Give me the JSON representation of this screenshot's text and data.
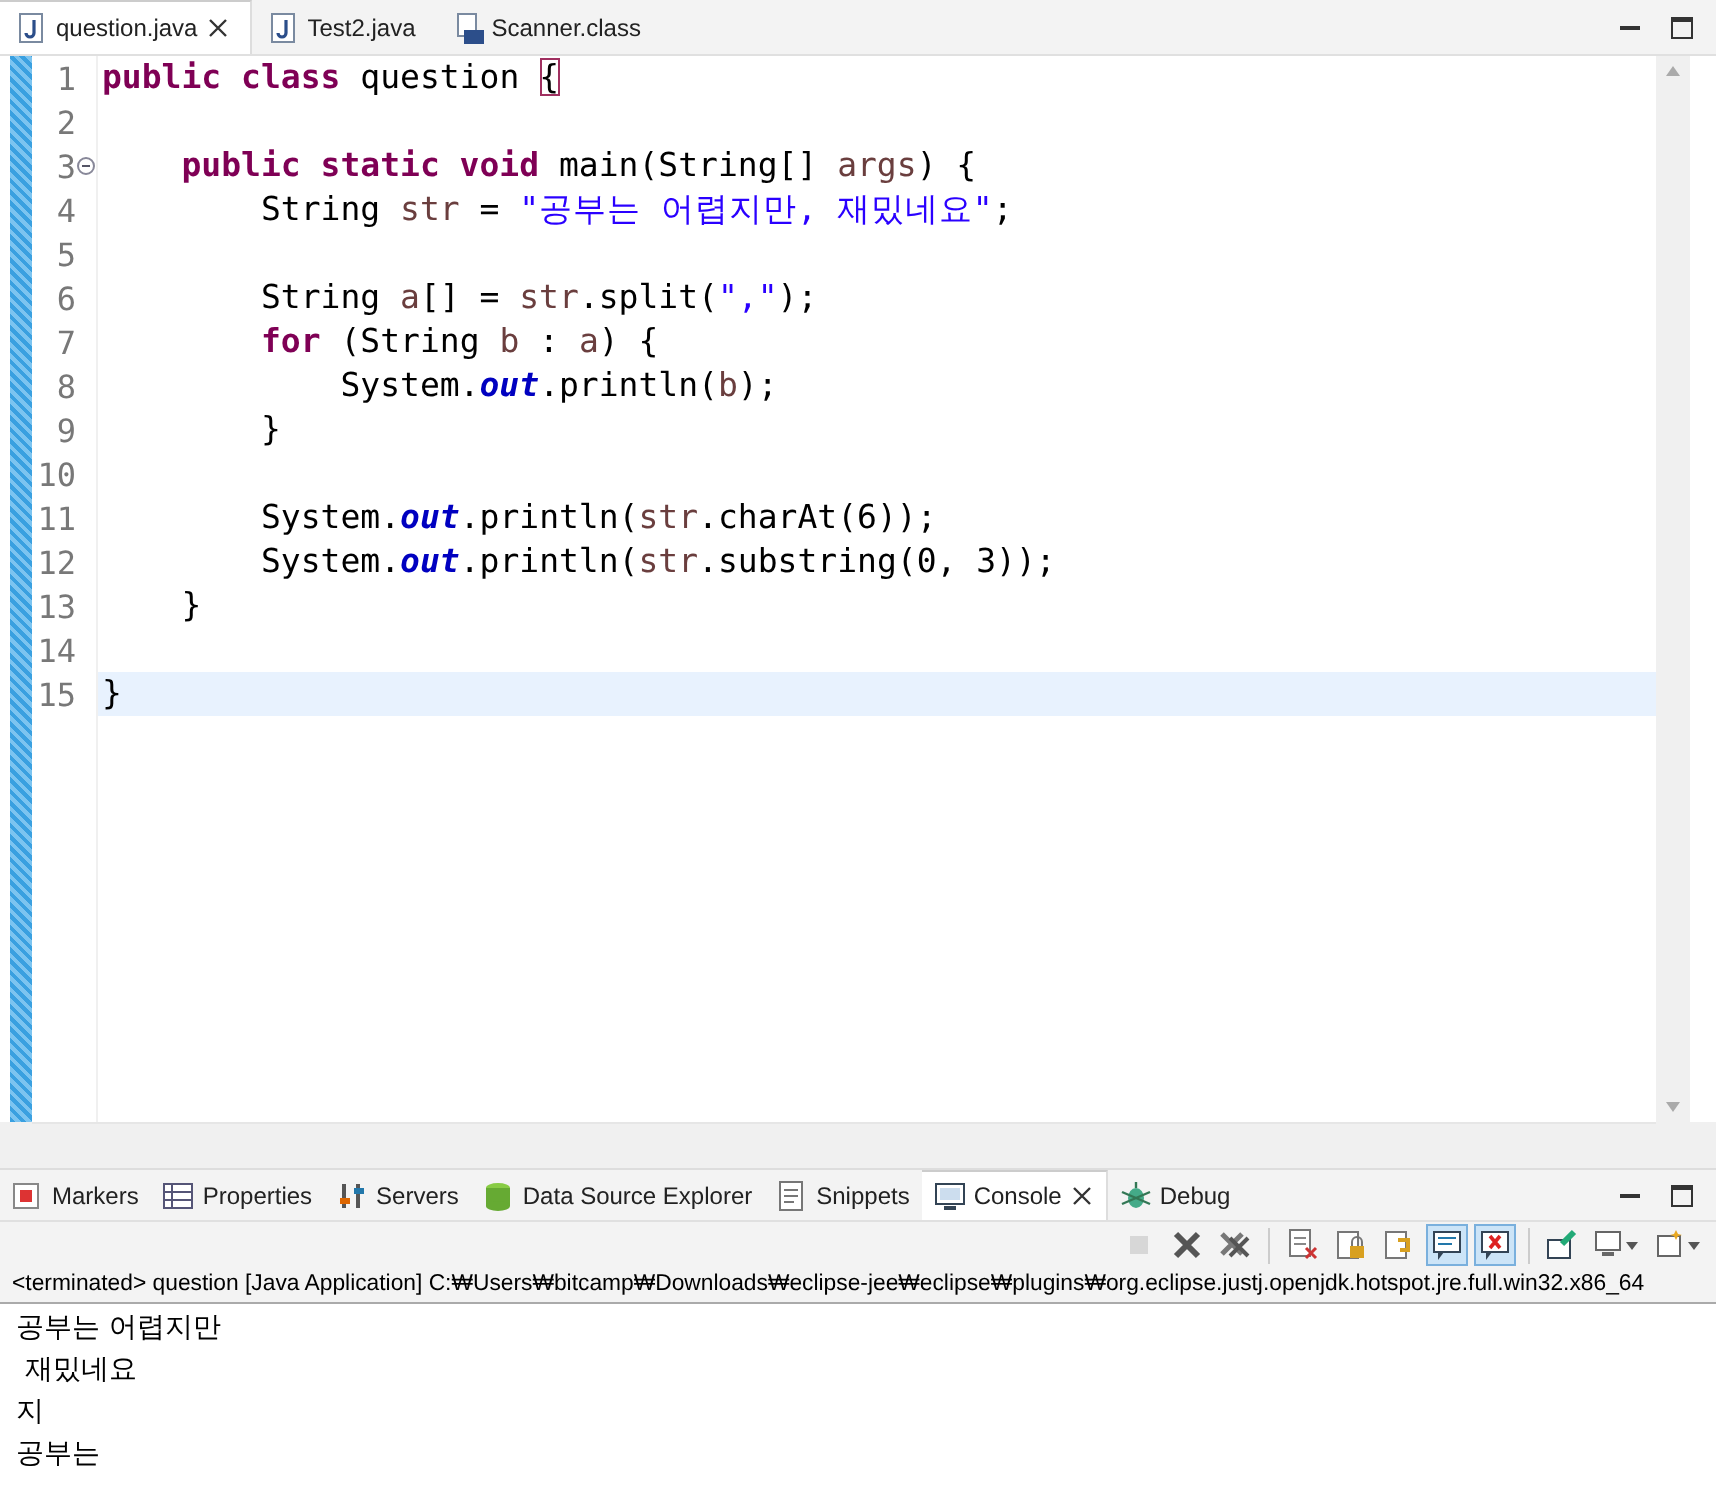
{
  "editor_tabs": [
    {
      "label": "question.java",
      "kind": "java",
      "selected": true,
      "closable": true
    },
    {
      "label": "Test2.java",
      "kind": "java",
      "selected": false,
      "closable": false
    },
    {
      "label": "Scanner.class",
      "kind": "class",
      "selected": false,
      "closable": false
    }
  ],
  "code_lines": [
    {
      "number": "1",
      "collapsible": false,
      "current": false,
      "tokens": [
        {
          "kind": "keyword",
          "text": "public class"
        },
        {
          "kind": "plain",
          "text": " question "
        },
        {
          "kind": "matched",
          "text": "{"
        }
      ]
    },
    {
      "number": "2",
      "collapsible": false,
      "current": false
    },
    {
      "number": "3",
      "collapsible": true,
      "current": false,
      "tokens": [
        {
          "kind": "keyword",
          "text": "    public static void"
        },
        {
          "kind": "plain",
          "text": " main(String[] "
        },
        {
          "kind": "variable",
          "text": "args"
        },
        {
          "kind": "plain",
          "text": ") {"
        }
      ]
    },
    {
      "number": "4",
      "collapsible": false,
      "current": false,
      "tokens": [
        {
          "kind": "plain",
          "text": "        String "
        },
        {
          "kind": "variable",
          "text": "str"
        },
        {
          "kind": "plain",
          "text": " = "
        },
        {
          "kind": "string",
          "text": "\"공부는 어렵지만, 재밌네요\""
        },
        {
          "kind": "plain",
          "text": ";"
        }
      ]
    },
    {
      "number": "5",
      "collapsible": false,
      "current": false
    },
    {
      "number": "6",
      "collapsible": false,
      "current": false,
      "tokens": [
        {
          "kind": "plain",
          "text": "        String "
        },
        {
          "kind": "variable",
          "text": "a"
        },
        {
          "kind": "plain",
          "text": "[] = "
        },
        {
          "kind": "variable",
          "text": "str"
        },
        {
          "kind": "plain",
          "text": ".split("
        },
        {
          "kind": "string",
          "text": "\",\""
        },
        {
          "kind": "plain",
          "text": ");"
        }
      ]
    },
    {
      "number": "7",
      "collapsible": false,
      "current": false,
      "tokens": [
        {
          "kind": "keyword",
          "text": "        for"
        },
        {
          "kind": "plain",
          "text": " (String "
        },
        {
          "kind": "variable",
          "text": "b"
        },
        {
          "kind": "plain",
          "text": " : "
        },
        {
          "kind": "variable",
          "text": "a"
        },
        {
          "kind": "plain",
          "text": ") {"
        }
      ]
    },
    {
      "number": "8",
      "collapsible": false,
      "current": false,
      "tokens": [
        {
          "kind": "plain",
          "text": "            System."
        },
        {
          "kind": "static",
          "text": "out"
        },
        {
          "kind": "plain",
          "text": ".println("
        },
        {
          "kind": "variable",
          "text": "b"
        },
        {
          "kind": "plain",
          "text": ");"
        }
      ]
    },
    {
      "number": "9",
      "collapsible": false,
      "current": false,
      "tokens": [
        {
          "kind": "plain",
          "text": "        }"
        }
      ]
    },
    {
      "number": "10",
      "collapsible": false,
      "current": false
    },
    {
      "number": "11",
      "collapsible": false,
      "current": false,
      "tokens": [
        {
          "kind": "plain",
          "text": "        System."
        },
        {
          "kind": "static",
          "text": "out"
        },
        {
          "kind": "plain",
          "text": ".println("
        },
        {
          "kind": "variable",
          "text": "str"
        },
        {
          "kind": "plain",
          "text": ".charAt(6));"
        }
      ]
    },
    {
      "number": "12",
      "collapsible": false,
      "current": false,
      "tokens": [
        {
          "kind": "plain",
          "text": "        System."
        },
        {
          "kind": "static",
          "text": "out"
        },
        {
          "kind": "plain",
          "text": ".println("
        },
        {
          "kind": "variable",
          "text": "str"
        },
        {
          "kind": "plain",
          "text": ".substring(0, 3));"
        }
      ]
    },
    {
      "number": "13",
      "collapsible": false,
      "current": false,
      "tokens": [
        {
          "kind": "plain",
          "text": "    }"
        }
      ]
    },
    {
      "number": "14",
      "collapsible": false,
      "current": false
    },
    {
      "number": "15",
      "collapsible": false,
      "current": true,
      "tokens": [
        {
          "kind": "plain",
          "text": "}"
        }
      ]
    }
  ],
  "view_tabs": [
    {
      "label": "Markers",
      "kind": "markers",
      "selected": false,
      "closable": false
    },
    {
      "label": "Properties",
      "kind": "properties",
      "selected": false,
      "closable": false
    },
    {
      "label": "Servers",
      "kind": "servers",
      "selected": false,
      "closable": false
    },
    {
      "label": "Data Source Explorer",
      "kind": "datasource",
      "selected": false,
      "closable": false
    },
    {
      "label": "Snippets",
      "kind": "snippets",
      "selected": false,
      "closable": false
    },
    {
      "label": "Console",
      "kind": "console",
      "selected": true,
      "closable": true
    },
    {
      "label": "Debug",
      "kind": "debug",
      "selected": false,
      "closable": false
    }
  ],
  "console_toolbar": [
    [
      {
        "kind": "terminate",
        "disabled": true,
        "on": false
      },
      {
        "kind": "remove",
        "disabled": false,
        "on": false
      },
      {
        "kind": "remove-all",
        "disabled": false,
        "on": false
      }
    ],
    [
      {
        "kind": "clear",
        "disabled": false,
        "on": false
      },
      {
        "kind": "lock",
        "disabled": false,
        "on": false
      },
      {
        "kind": "wrap",
        "disabled": false,
        "on": false
      },
      {
        "kind": "stdout",
        "disabled": false,
        "on": true
      },
      {
        "kind": "stderr",
        "disabled": false,
        "on": true
      }
    ],
    [
      {
        "kind": "pin",
        "disabled": false,
        "on": false
      },
      {
        "kind": "display",
        "disabled": false,
        "on": false
      },
      {
        "kind": "open",
        "disabled": false,
        "on": false
      }
    ]
  ],
  "console": {
    "header": "<terminated> question [Java Application] C:₩Users₩bitcamp₩Downloads₩eclipse-jee₩eclipse₩plugins₩org.eclipse.justj.openjdk.hotspot.jre.full.win32.x86_64",
    "output": [
      "공부는 어렵지만",
      " 재밌네요",
      "지",
      "공부는"
    ]
  }
}
